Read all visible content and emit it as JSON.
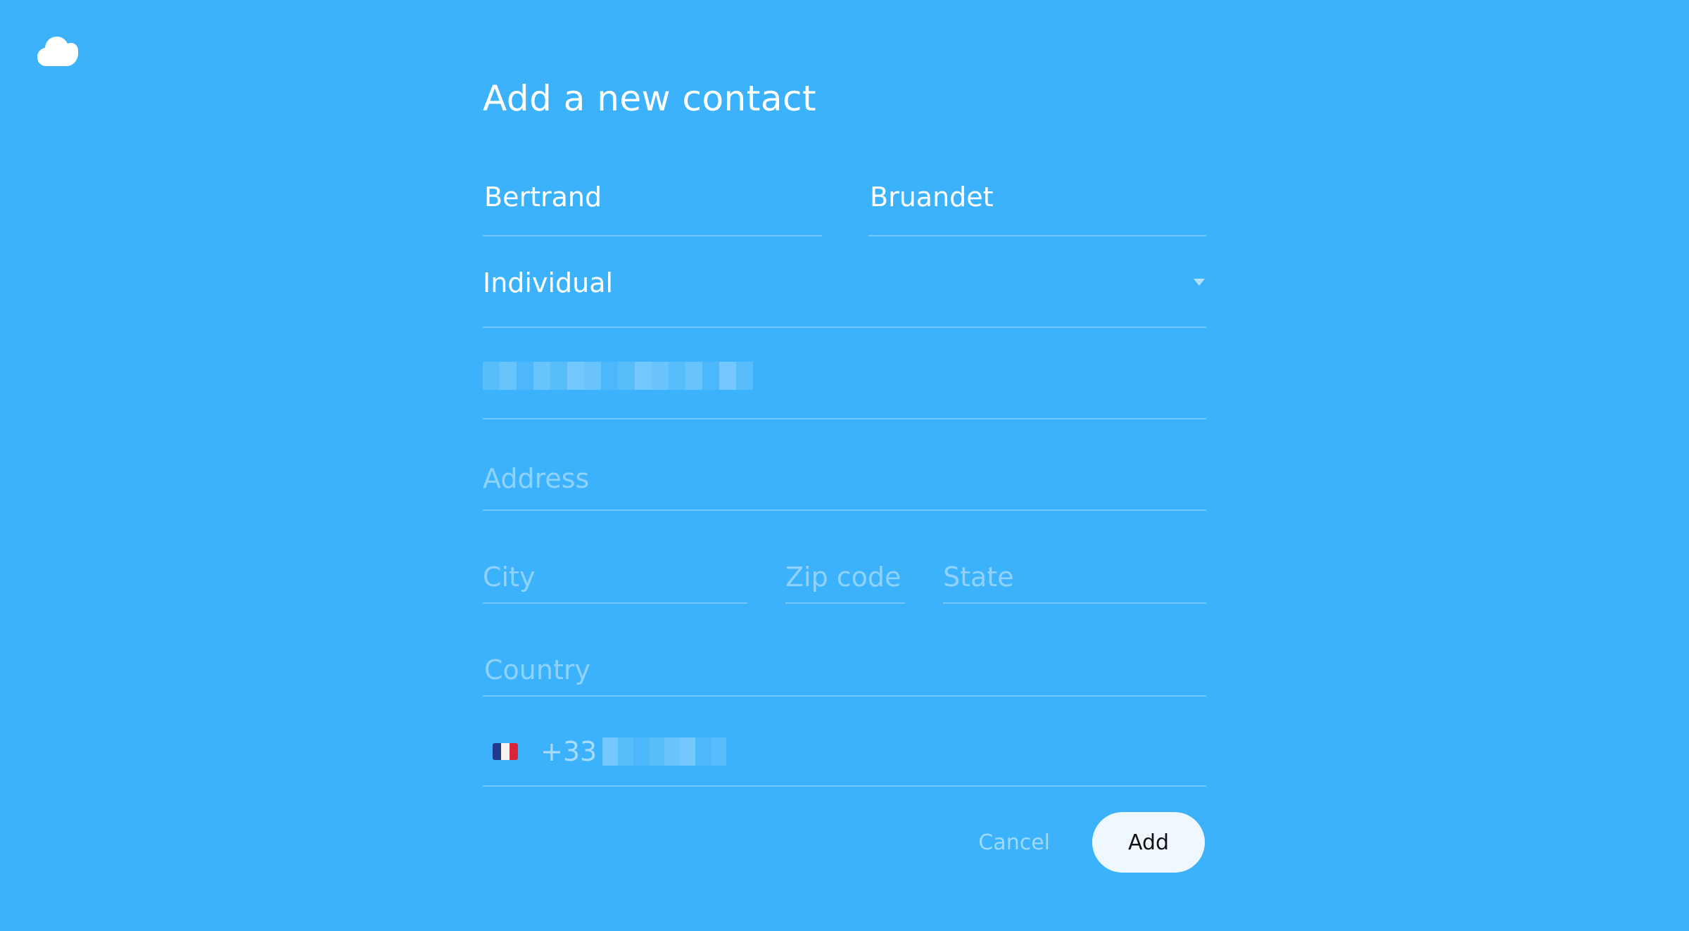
{
  "form": {
    "title": "Add a new contact",
    "first_name": {
      "value": "Bertrand"
    },
    "last_name": {
      "value": "Bruandet"
    },
    "contact_type": {
      "selected": "Individual"
    },
    "email": {
      "value_state": "redacted"
    },
    "address": {
      "value": "",
      "placeholder": "Address"
    },
    "city": {
      "value": "",
      "placeholder": "City"
    },
    "zip": {
      "value": "",
      "placeholder": "Zip code"
    },
    "state": {
      "value": "",
      "placeholder": "State"
    },
    "country": {
      "value": "",
      "placeholder": "Country"
    },
    "phone": {
      "flag_icon": "france-flag-icon",
      "prefix": "+33",
      "number_state": "redacted"
    }
  },
  "actions": {
    "cancel_label": "Cancel",
    "add_label": "Add"
  },
  "icons": {
    "logo": "cloud-icon",
    "select_caret": "chevron-down-icon"
  },
  "colors": {
    "background": "#3db2fc",
    "add_button_bg": "#eef8fe",
    "text": "#ffffff"
  }
}
